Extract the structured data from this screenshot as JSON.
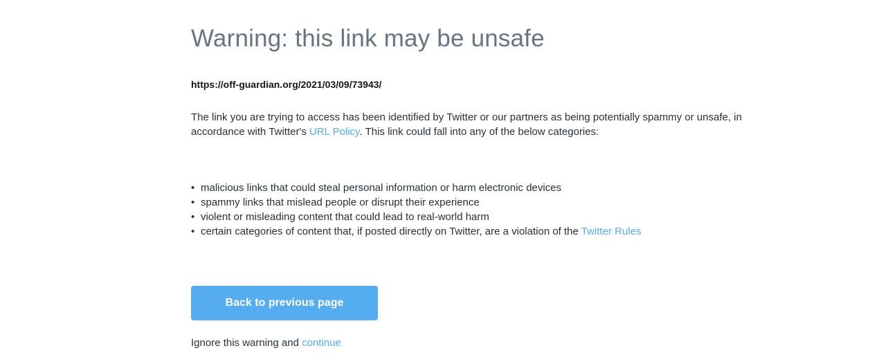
{
  "warning": {
    "title": "Warning: this link may be unsafe",
    "url": "https://off-guardian.org/2021/03/09/73943/",
    "description": {
      "part1": "The link you are trying to access has been identified by Twitter or our partners as being potentially spammy or unsafe, in accordance with Twitter's ",
      "url_policy_link": "URL Policy",
      "part2": ". This link could fall into any of the below categories:"
    },
    "categories": [
      "malicious links that could steal personal information or harm electronic devices",
      "spammy links that mislead people or disrupt their experience",
      "violent or misleading content that could lead to real-world harm",
      "certain categories of content that, if posted directly on Twitter, are a violation of the "
    ],
    "twitter_rules_link": "Twitter Rules",
    "back_button_label": "Back to previous page",
    "ignore_text": "Ignore this warning and ",
    "continue_link": "continue"
  },
  "colors": {
    "title": "#66757f",
    "link": "#55acee",
    "button_background": "#55acee",
    "button_text": "#ffffff"
  }
}
